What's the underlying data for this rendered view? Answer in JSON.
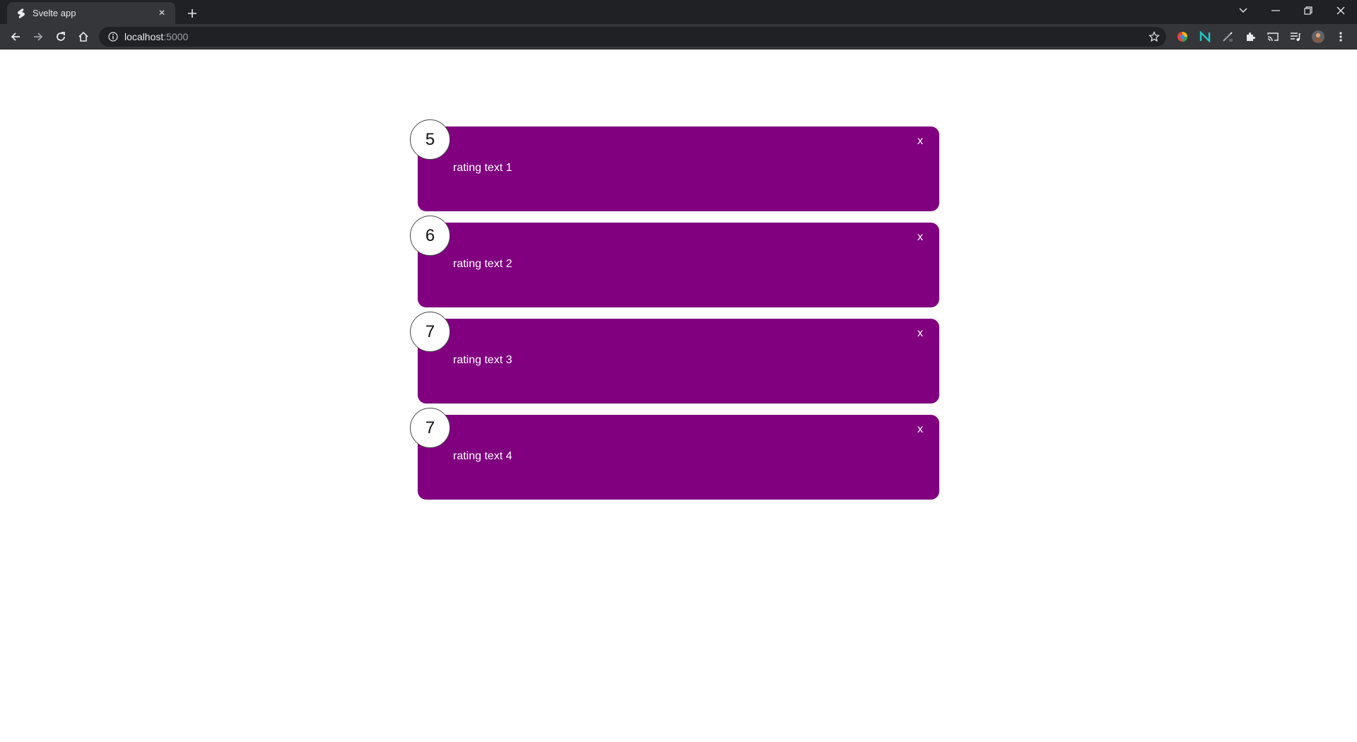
{
  "browser": {
    "tab_title": "Svelte app",
    "tab_close": "×",
    "url_host": "localhost",
    "url_port": ":5000",
    "icons": [
      "back-icon",
      "forward-icon",
      "reload-icon",
      "home-icon",
      "info-icon",
      "star-icon",
      "extensions-icon",
      "cast-icon",
      "media-icon",
      "profile-icon",
      "menu-icon"
    ]
  },
  "feedback": {
    "items": [
      {
        "rating": "5",
        "text": "rating text 1",
        "close": "x"
      },
      {
        "rating": "6",
        "text": "rating text 2",
        "close": "x"
      },
      {
        "rating": "7",
        "text": "rating text 3",
        "close": "x"
      },
      {
        "rating": "7",
        "text": "rating text 4",
        "close": "x"
      }
    ]
  },
  "colors": {
    "card_background": "#800080",
    "chrome_dark": "#202124",
    "chrome_toolbar": "#35363a"
  }
}
